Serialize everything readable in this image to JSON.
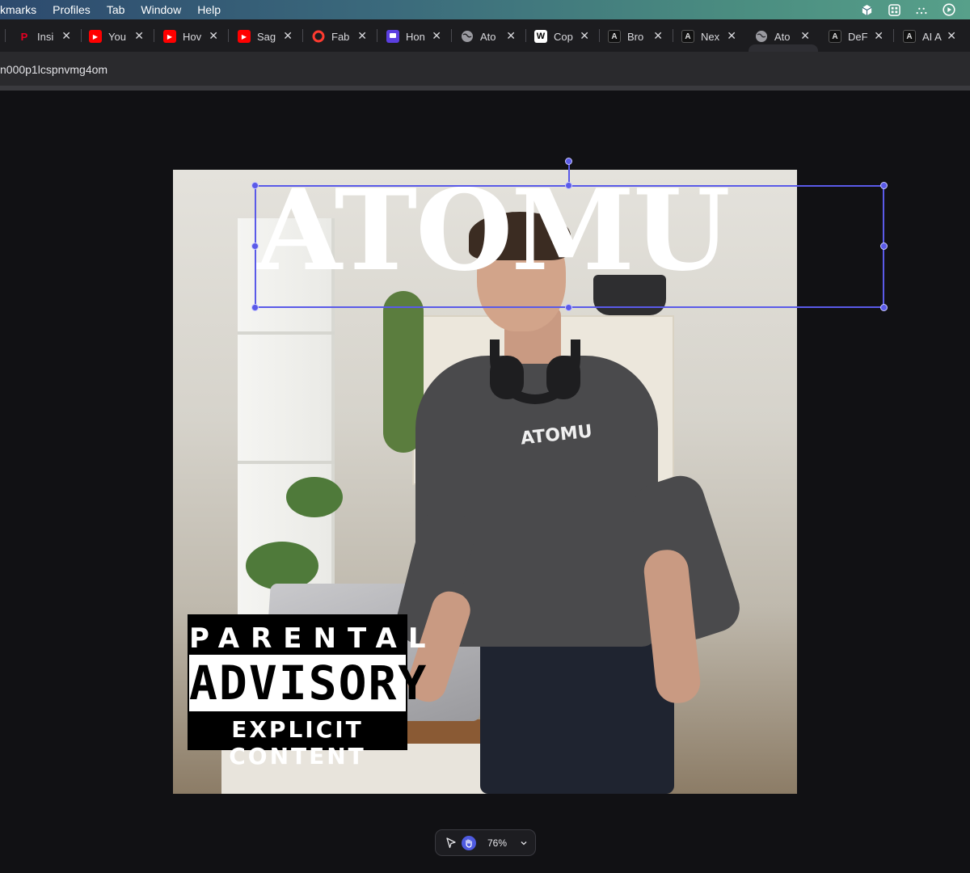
{
  "menubar": {
    "items": [
      "kmarks",
      "Profiles",
      "Tab",
      "Window",
      "Help"
    ]
  },
  "tabs": [
    {
      "title": "Insi",
      "favicon": "pinterest-icon",
      "color": "#e60023"
    },
    {
      "title": "You",
      "favicon": "youtube-icon",
      "color": "#ff0000"
    },
    {
      "title": "Hov",
      "favicon": "youtube-icon",
      "color": "#ff0000"
    },
    {
      "title": "Sag",
      "favicon": "youtube-icon",
      "color": "#ff0000"
    },
    {
      "title": "Fab",
      "favicon": "lifebuoy-icon",
      "color": "#ff3b30"
    },
    {
      "title": "Hon",
      "favicon": "purple-app-icon",
      "color": "#5b3fe0"
    },
    {
      "title": "Ato",
      "favicon": "globe-icon",
      "color": "#9a9aa0"
    },
    {
      "title": "Cop",
      "favicon": "w-icon",
      "color": "#ffffff"
    },
    {
      "title": "Bro",
      "favicon": "a-logo-icon",
      "color": "#222222"
    },
    {
      "title": "Nex",
      "favicon": "a-logo-icon",
      "color": "#222222"
    },
    {
      "title": "Ato",
      "favicon": "globe-icon",
      "color": "#9a9aa0",
      "active": true
    },
    {
      "title": "DeF",
      "favicon": "a-logo-icon",
      "color": "#222222"
    },
    {
      "title": "AI A",
      "favicon": "a-logo-icon",
      "color": "#222222"
    }
  ],
  "url": {
    "text": "n000p1lcspnvmg4om"
  },
  "artwork": {
    "title": "ATOMU",
    "shirt_text": "ATOMU",
    "parental_top": "PARENTAL",
    "parental_mid": "ADVISORY",
    "parental_bottom": "EXPLICIT CONTENT"
  },
  "zoom": {
    "value": "76%"
  },
  "colors": {
    "selection": "#5a5ae8",
    "hand_tool_active": "#4f5be0"
  }
}
